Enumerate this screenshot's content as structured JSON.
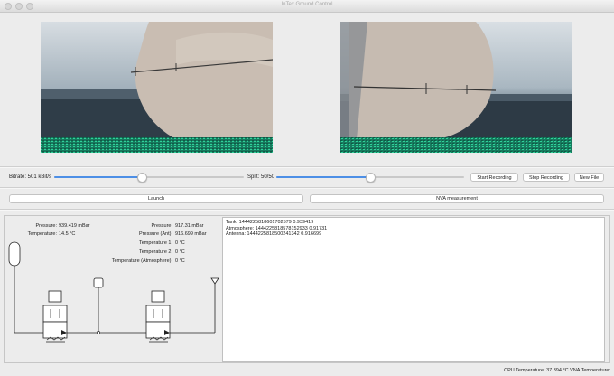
{
  "window": {
    "title": "InTex Ground Control"
  },
  "video": {
    "left_feed": "left-camera-feed",
    "right_feed": "right-camera-feed"
  },
  "controls": {
    "bitrate_label": "Bitrate: 501 kBit/s",
    "bitrate_value": 0.46,
    "split_label": "Split: 50/50",
    "split_value": 0.5,
    "start_recording": "Start Recording",
    "stop_recording": "Stop Recording",
    "new_file": "New File"
  },
  "actions": {
    "launch": "Launch",
    "nva_measurement": "NVA measurement"
  },
  "sensors_left": [
    {
      "label": "Pressure:",
      "value": "939.419 mBar"
    },
    {
      "label": "Temperature:",
      "value": "14.5 °C"
    }
  ],
  "sensors_right": [
    {
      "label": "Pressure:",
      "value": "917.31 mBar"
    },
    {
      "label": "Pressure (Ant):",
      "value": "916.699 mBar"
    },
    {
      "label": "Temperature 1:",
      "value": "0 °C"
    },
    {
      "label": "Temperature 2:",
      "value": "0 °C"
    },
    {
      "label": "Temperature (Atmosphere):",
      "value": "0 °C"
    }
  ],
  "log": [
    "Tank: 1444225818601702579 0.939419",
    "Atmosphere: 1444225818578152933 0.91731",
    "Antenna: 1444225818500241342 0.916699"
  ],
  "status": {
    "cpu": "CPU Temperature: 37.394 °C",
    "vna": "VNA Temperature:"
  },
  "colors": {
    "accent": "#4d8fe6",
    "noise_green": "#1fb585"
  }
}
